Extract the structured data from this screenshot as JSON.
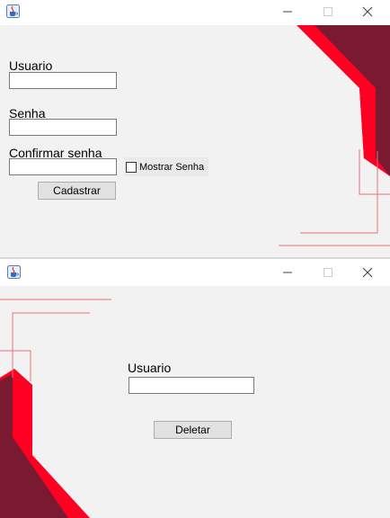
{
  "window_controls": {
    "minimize_icon": "minimize-icon",
    "maximize_icon": "maximize-icon",
    "close_icon": "close-icon"
  },
  "colors": {
    "content_bg": "#f2f2f2",
    "accent_red": "#ff0022",
    "accent_dark": "#7a1a30",
    "line_red": "#e8707a"
  },
  "register_window": {
    "app_icon": "java-cup-icon",
    "username_label": "Usuario",
    "username_value": "",
    "password_label": "Senha",
    "password_value": "",
    "confirm_label": "Confirmar senha",
    "confirm_value": "",
    "show_password_label": "Mostrar Senha",
    "show_password_checked": false,
    "submit_label": "Cadastrar"
  },
  "delete_window": {
    "app_icon": "java-cup-icon",
    "username_label": "Usuario",
    "username_value": "",
    "delete_label": "Deletar"
  }
}
